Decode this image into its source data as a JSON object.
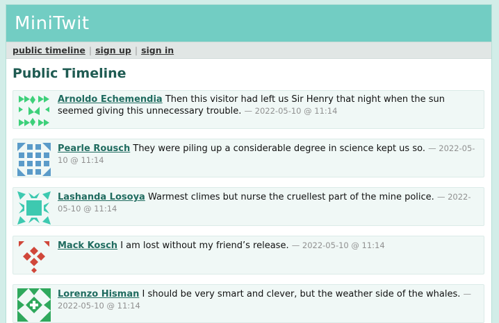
{
  "app": {
    "title": "MiniTwit"
  },
  "nav": {
    "items": [
      {
        "label": "public timeline"
      },
      {
        "label": "sign up"
      },
      {
        "label": "sign in"
      }
    ],
    "separator": "|"
  },
  "main": {
    "heading": "Public Timeline"
  },
  "messages": [
    {
      "author": "Arnoldo Echemendia",
      "text": "Then this visitor had left us Sir Henry that night when the sun seemed giving this unnecessary trouble.",
      "date": "— 2022-05-10 @ 11:14",
      "avatar_color": "#3dd07a",
      "avatar_icon": "identicon-arrows-icon"
    },
    {
      "author": "Pearle Rousch",
      "text": "They were piling up a considerable degree in science kept us so.",
      "date": "— 2022-05-10 @ 11:14",
      "avatar_color": "#5b9bc9",
      "avatar_icon": "identicon-lattice-icon"
    },
    {
      "author": "Lashanda Losoya",
      "text": "Warmest climes but nurse the cruellest part of the mine police.",
      "date": "— 2022-05-10 @ 11:14",
      "avatar_color": "#3dc9b0",
      "avatar_icon": "identicon-square-icon"
    },
    {
      "author": "Mack Kosch",
      "text": "I am lost without my friend’s release.",
      "date": "— 2022-05-10 @ 11:14",
      "avatar_color": "#d0473a",
      "avatar_icon": "identicon-diamonds-icon"
    },
    {
      "author": "Lorenzo Hisman",
      "text": "I should be very smart and clever, but the weather side of the whales.",
      "date": "— 2022-05-10 @ 11:14",
      "avatar_color": "#2fa85c",
      "avatar_icon": "identicon-pinwheel-icon"
    }
  ]
}
